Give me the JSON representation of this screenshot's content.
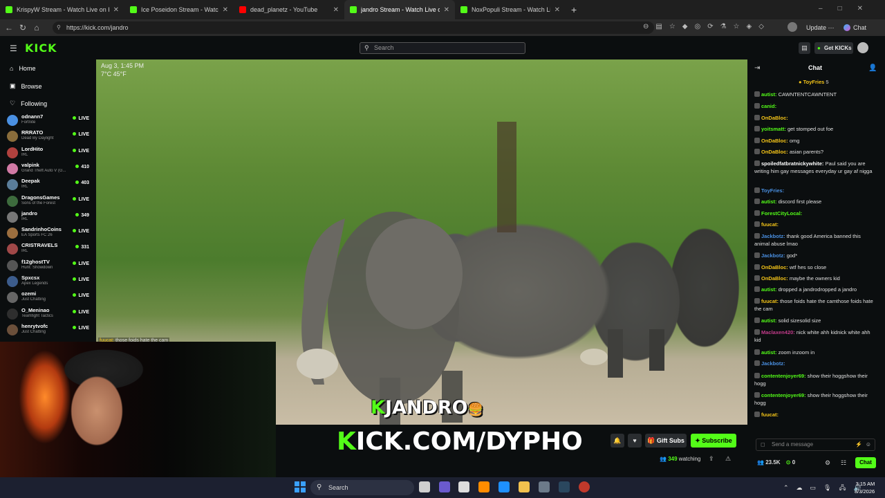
{
  "browser": {
    "tabs": [
      {
        "title": "KrispyW Stream - Watch Live on Kick",
        "color": "#53fc18"
      },
      {
        "title": "Ice Poseidon Stream - Watch Live on Kick",
        "color": "#53fc18"
      },
      {
        "title": "dead_planetz - YouTube",
        "color": "#ff0000"
      },
      {
        "title": "jandro Stream - Watch Live on Kick",
        "color": "#53fc18"
      },
      {
        "title": "NoxPopuli Stream - Watch Live on Kick",
        "color": "#53fc18"
      }
    ],
    "url": "https://kick.com/jandro",
    "update_label": "Update",
    "chat_label": "Chat"
  },
  "kick": {
    "logo": "KICK",
    "search_placeholder": "Search",
    "get_kicks": "Get KICKs"
  },
  "sidebar": {
    "nav": [
      "Home",
      "Browse",
      "Following"
    ],
    "channels": [
      {
        "name": "odnann7",
        "game": "Fortnite",
        "status": "LIVE",
        "color": "#4a90e2"
      },
      {
        "name": "RRRATO",
        "game": "Dead By Daylight",
        "status": "LIVE",
        "color": "#8a6d3b"
      },
      {
        "name": "LordHito",
        "game": "IRL",
        "status": "LIVE",
        "color": "#b0413e"
      },
      {
        "name": "valpink",
        "game": "Grand Theft Auto V (G...",
        "status": "410",
        "color": "#d17aa5"
      },
      {
        "name": "Deepak",
        "game": "IRL",
        "status": "403",
        "color": "#5a7d9a"
      },
      {
        "name": "DragonsGames",
        "game": "Sons of the Forest",
        "status": "LIVE",
        "color": "#3d6b3d"
      },
      {
        "name": "jandro",
        "game": "IRL",
        "status": "349",
        "color": "#777777"
      },
      {
        "name": "SandrinhoCoins",
        "game": "EA Sports FC 26",
        "status": "LIVE",
        "color": "#9c6f3f"
      },
      {
        "name": "CRISTRAVELS",
        "game": "IRL",
        "status": "331",
        "color": "#a04848"
      },
      {
        "name": "f12ghostTV",
        "game": "Hunt: Showdown",
        "status": "LIVE",
        "color": "#555555"
      },
      {
        "name": "Spxcsx",
        "game": "Apex Legends",
        "status": "LIVE",
        "color": "#3c5c8c"
      },
      {
        "name": "ozemi",
        "game": "Just Chatting",
        "status": "LIVE",
        "color": "#666666"
      },
      {
        "name": "O_Meninao",
        "game": "Teamfight Tactics",
        "status": "LIVE",
        "color": "#2e2e2e"
      },
      {
        "name": "henrytvofc",
        "game": "Just Chatting",
        "status": "LIVE",
        "color": "#6b4f3a"
      }
    ]
  },
  "video": {
    "overlay_date": "Aug 3, 1:45 PM",
    "overlay_temp": "7°C 45°F",
    "chat_overlay_user": "fuucat:",
    "chat_overlay_text": "those foids hate the cam",
    "jandro_logo_k": "K",
    "jandro_logo": "JANDRO",
    "banner_k": "K",
    "banner": "ICK.COM/DYPHO"
  },
  "actions": {
    "gift_subs": "Gift Subs",
    "subscribe": "Subscribe",
    "watching_count": "349",
    "watching_label": "watching"
  },
  "chat": {
    "header": "Chat",
    "pinned_user": "ToyFries",
    "pinned_count": "5",
    "messages": [
      {
        "user": "autist:",
        "text": "CAWNTENTCAWNTENT",
        "color": "#53fc18"
      },
      {
        "user": "canid:",
        "text": "",
        "color": "#53fc18"
      },
      {
        "user": "OnDaBloc:",
        "text": "",
        "color": "#f5c518"
      },
      {
        "user": "yoitsmatt:",
        "text": "get stomped out foe",
        "color": "#53fc18"
      },
      {
        "user": "OnDaBloc:",
        "text": "omg",
        "color": "#f5c518"
      },
      {
        "user": "OnDaBloc:",
        "text": "asian parents?",
        "color": "#f5c518"
      },
      {
        "user": "spoiledfatbratnickywhite:",
        "text": "Paul said you are writing him gay messages everyday ur gay af nigga",
        "color": "#ffffff"
      },
      {
        "user": "ToyFries:",
        "text": "",
        "color": "#4a90e2"
      },
      {
        "user": "autist:",
        "text": "discord first please",
        "color": "#53fc18"
      },
      {
        "user": "ForestCityLocal:",
        "text": "",
        "color": "#53fc18"
      },
      {
        "user": "fuucat:",
        "text": "",
        "color": "#f5c518"
      },
      {
        "user": "Jackbotz:",
        "text": "thank good America banned this animal abuse lmao",
        "color": "#4a90e2"
      },
      {
        "user": "Jackbotz:",
        "text": "god*",
        "color": "#4a90e2"
      },
      {
        "user": "OnDaBloc:",
        "text": "wtf hes so close",
        "color": "#f5c518"
      },
      {
        "user": "OnDaBloc:",
        "text": "maybe the owners kid",
        "color": "#f5c518"
      },
      {
        "user": "autist:",
        "text": "dropped a jandrodropped a jandro",
        "color": "#53fc18"
      },
      {
        "user": "fuucat:",
        "text": "those foids hate the camthose foids hate the cam",
        "color": "#f5c518"
      },
      {
        "user": "autist:",
        "text": "solid sizesolid size",
        "color": "#53fc18"
      },
      {
        "user": "Maclaxen420:",
        "text": "nick white ahh kidnick white ahh kid",
        "color": "#c23b8a"
      },
      {
        "user": "autist:",
        "text": "zoom inzoom in",
        "color": "#53fc18"
      },
      {
        "user": "Jackbotz:",
        "text": "",
        "color": "#4a90e2"
      },
      {
        "user": "contentenjoyer69:",
        "text": "show their hoggshow their hogg",
        "color": "#53fc18"
      },
      {
        "user": "contentenjoyer69:",
        "text": "show their hoggshow their hogg",
        "color": "#53fc18"
      },
      {
        "user": "fuucat:",
        "text": "",
        "color": "#f5c518"
      }
    ],
    "input_placeholder": "Send a message",
    "followers": "23.5K",
    "kicks": "0",
    "chat_button": "Chat"
  },
  "taskbar": {
    "search": "Search",
    "time": "3:15 AM",
    "date": "8/3/2026"
  }
}
